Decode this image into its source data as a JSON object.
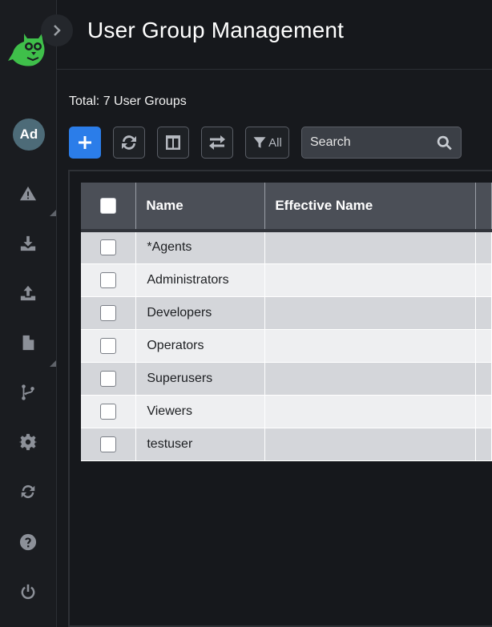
{
  "header": {
    "title": "User Group Management"
  },
  "user": {
    "initials": "Ad"
  },
  "sidebar": {
    "icons": [
      "alert-icon",
      "download-icon",
      "upload-icon",
      "file-icon",
      "branch-icon",
      "gear-icon",
      "sync-icon",
      "help-icon",
      "power-icon"
    ]
  },
  "summary": {
    "total_text": "Total: 7 User Groups"
  },
  "toolbar": {
    "filter_label": "All",
    "search_placeholder": "Search"
  },
  "table": {
    "columns": [
      "Name",
      "Effective Name",
      ""
    ],
    "rows": [
      {
        "name": "*Agents",
        "effective_name": ""
      },
      {
        "name": "Administrators",
        "effective_name": ""
      },
      {
        "name": "Developers",
        "effective_name": ""
      },
      {
        "name": "Operators",
        "effective_name": ""
      },
      {
        "name": "Superusers",
        "effective_name": ""
      },
      {
        "name": "Viewers",
        "effective_name": ""
      },
      {
        "name": "testuser",
        "effective_name": ""
      }
    ]
  },
  "colors": {
    "accent": "#2b7de9",
    "logo": "#3fbf4a",
    "avatar": "#4d6b78"
  }
}
